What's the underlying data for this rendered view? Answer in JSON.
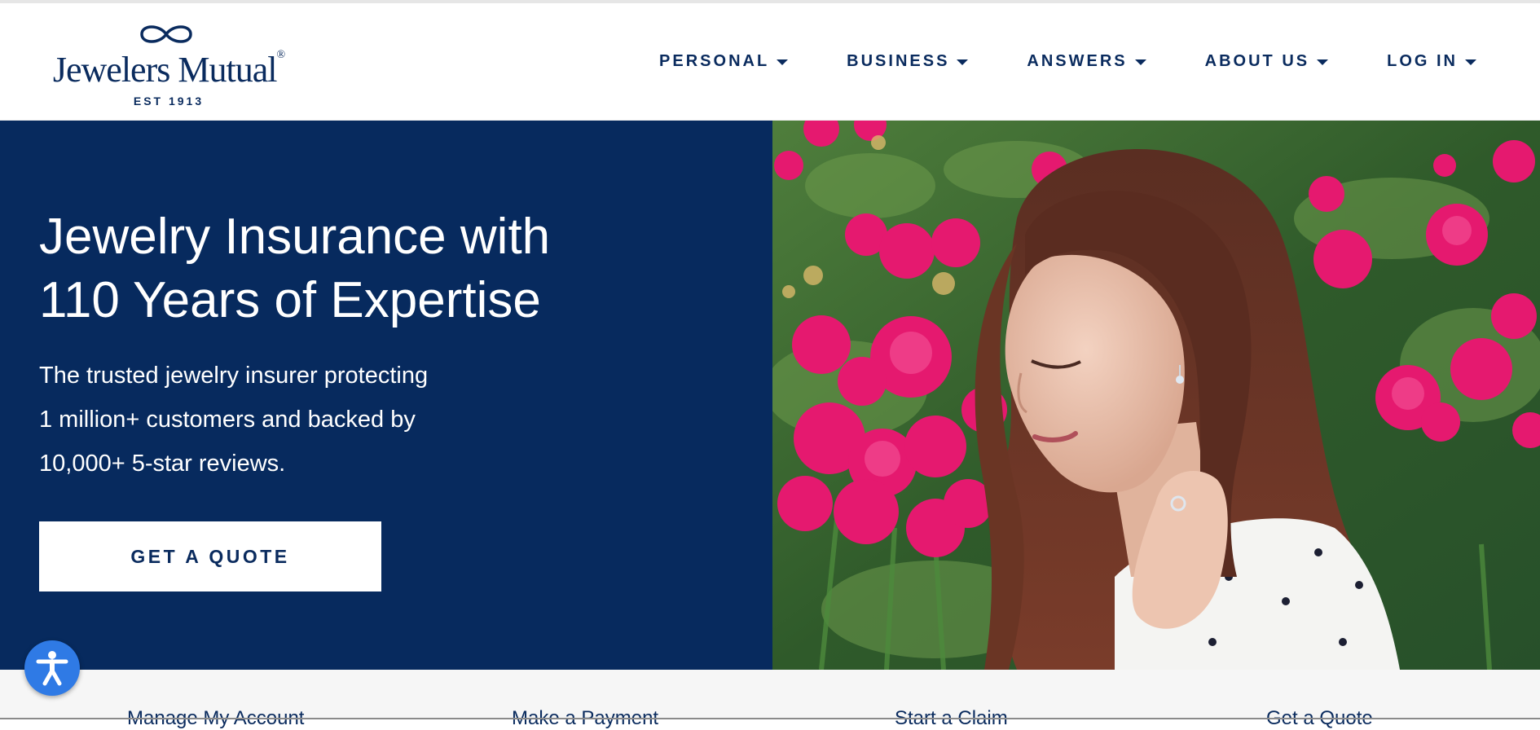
{
  "logo": {
    "wordmark": "Jewelers Mutual",
    "registered": "®",
    "tagline": "EST 1913"
  },
  "nav": {
    "items": [
      {
        "label": "PERSONAL"
      },
      {
        "label": "BUSINESS"
      },
      {
        "label": "ANSWERS"
      },
      {
        "label": "ABOUT US"
      },
      {
        "label": "LOG IN"
      }
    ],
    "caret_icon": "caret-down-icon"
  },
  "hero": {
    "title_line1": "Jewelry Insurance with",
    "title_line2": "110 Years of Expertise",
    "sub_line1": "The trusted jewelry insurer protecting",
    "sub_line2": "1 million+ customers and backed by",
    "sub_line3": "10,000+ 5-star reviews.",
    "cta_label": "GET A QUOTE",
    "image_icon": "woman-in-flower-field-photo"
  },
  "quick_links": {
    "items": [
      {
        "label": "Manage My Account"
      },
      {
        "label": "Make a Payment"
      },
      {
        "label": "Start a Claim"
      },
      {
        "label": "Get a Quote"
      }
    ]
  },
  "accessibility": {
    "icon": "accessibility-icon"
  },
  "colors": {
    "navy": "#072a5e",
    "text_navy": "#0a2b5e",
    "white": "#ffffff",
    "accessibility_blue": "#2f7ae5",
    "strip_gray": "#f6f6f6"
  }
}
